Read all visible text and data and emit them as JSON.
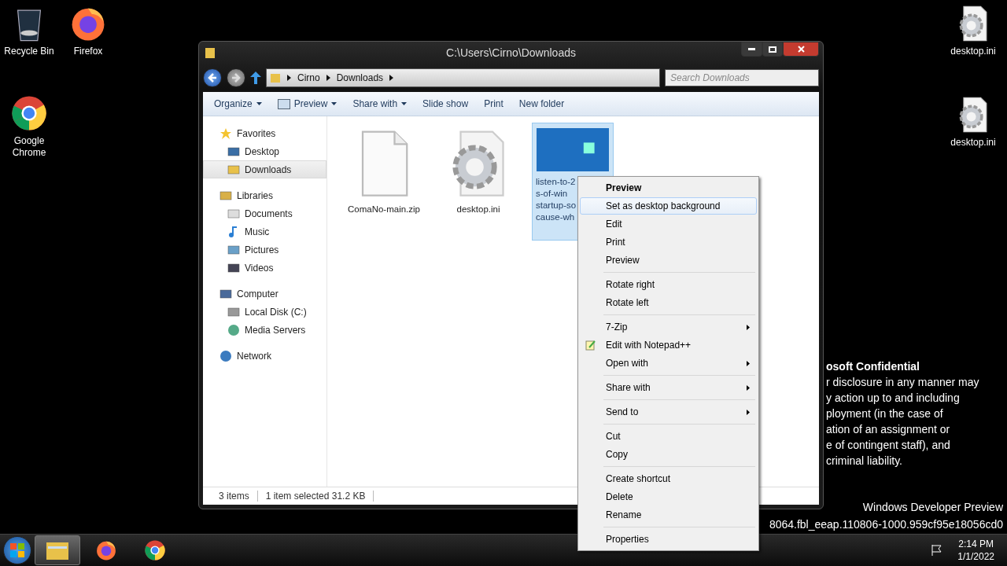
{
  "desktop_icons_left": [
    {
      "label": "Recycle Bin",
      "kind": "bin"
    },
    {
      "label": "Firefox",
      "kind": "firefox"
    },
    {
      "label": "Google Chrome",
      "kind": "chrome"
    }
  ],
  "desktop_icons_right": [
    {
      "label": "desktop.ini",
      "kind": "ini"
    },
    {
      "label": "desktop.ini",
      "kind": "ini"
    }
  ],
  "watermark": {
    "title": "osoft Confidential",
    "lines": [
      "r disclosure in any manner may",
      "y action up to and including",
      "ployment (in the case of",
      "ation of an assignment or",
      "e of contingent staff), and",
      "criminal liability."
    ],
    "edition": "Windows Developer Preview",
    "build": "8064.fbl_eeap.110806-1000.959cf95e18056cd0"
  },
  "window": {
    "title": "C:\\Users\\Cirno\\Downloads",
    "address": [
      "Cirno",
      "Downloads"
    ],
    "search": {
      "placeholder": "Search Downloads"
    },
    "toolbar": [
      {
        "label": "Organize",
        "dropdown": true,
        "kind": "plain"
      },
      {
        "label": "Preview",
        "dropdown": true,
        "kind": "preview"
      },
      {
        "label": "Share with",
        "dropdown": true,
        "kind": "plain"
      },
      {
        "label": "Slide show",
        "dropdown": false,
        "kind": "plain"
      },
      {
        "label": "Print",
        "dropdown": false,
        "kind": "plain"
      },
      {
        "label": "New folder",
        "dropdown": false,
        "kind": "plain"
      }
    ],
    "nav": [
      {
        "label": "Favorites",
        "kind": "star",
        "children": [
          {
            "label": "Desktop",
            "kind": "desktop",
            "selected": false
          },
          {
            "label": "Downloads",
            "kind": "downloads",
            "selected": true
          }
        ]
      },
      {
        "label": "Libraries",
        "kind": "libraries",
        "children": [
          {
            "label": "Documents",
            "kind": "documents",
            "selected": false
          },
          {
            "label": "Music",
            "kind": "music",
            "selected": false
          },
          {
            "label": "Pictures",
            "kind": "pictures",
            "selected": false
          },
          {
            "label": "Videos",
            "kind": "videos",
            "selected": false
          }
        ]
      },
      {
        "label": "Computer",
        "kind": "computer",
        "children": [
          {
            "label": "Local Disk (C:)",
            "kind": "disk",
            "selected": false
          },
          {
            "label": "Media Servers",
            "kind": "media",
            "selected": false
          }
        ]
      },
      {
        "label": "Network",
        "kind": "network"
      }
    ],
    "files": [
      {
        "name": "ComaNo-main.zip",
        "kind": "blank",
        "selected": false
      },
      {
        "name": "desktop.ini",
        "kind": "ini",
        "selected": false
      },
      {
        "name": "listen-to-2\ns-of-win\nstartup-so\ncause-wh",
        "kind": "image",
        "selected": true
      }
    ],
    "status": {
      "count": "3 items",
      "selection": "1 item selected",
      "size": "31.2 KB"
    }
  },
  "context_menu": [
    {
      "label": "Preview",
      "kind": "item",
      "bold": true,
      "selected": false
    },
    {
      "label": "Set as desktop background",
      "kind": "item",
      "bold": false,
      "selected": true
    },
    {
      "label": "Edit",
      "kind": "item",
      "bold": false,
      "selected": false
    },
    {
      "label": "Print",
      "kind": "item",
      "bold": false,
      "selected": false
    },
    {
      "label": "Preview",
      "kind": "item",
      "bold": false,
      "selected": false
    },
    {
      "kind": "separator"
    },
    {
      "label": "Rotate right",
      "kind": "item",
      "bold": false,
      "selected": false
    },
    {
      "label": "Rotate left",
      "kind": "item",
      "bold": false,
      "selected": false
    },
    {
      "kind": "separator"
    },
    {
      "label": "7-Zip",
      "kind": "submenu",
      "bold": false,
      "selected": false
    },
    {
      "label": "Edit with Notepad++",
      "kind": "notepad",
      "bold": false,
      "selected": false
    },
    {
      "label": "Open with",
      "kind": "submenu",
      "bold": false,
      "selected": false
    },
    {
      "kind": "separator"
    },
    {
      "label": "Share with",
      "kind": "submenu",
      "bold": false,
      "selected": false
    },
    {
      "kind": "separator"
    },
    {
      "label": "Send to",
      "kind": "submenu",
      "bold": false,
      "selected": false
    },
    {
      "kind": "separator"
    },
    {
      "label": "Cut",
      "kind": "item",
      "bold": false,
      "selected": false
    },
    {
      "label": "Copy",
      "kind": "item",
      "bold": false,
      "selected": false
    },
    {
      "kind": "separator"
    },
    {
      "label": "Create shortcut",
      "kind": "item",
      "bold": false,
      "selected": false
    },
    {
      "label": "Delete",
      "kind": "item",
      "bold": false,
      "selected": false
    },
    {
      "label": "Rename",
      "kind": "item",
      "bold": false,
      "selected": false
    },
    {
      "kind": "separator"
    },
    {
      "label": "Properties",
      "kind": "item",
      "bold": false,
      "selected": false
    }
  ],
  "taskbar": {
    "apps": [
      {
        "kind": "explorer",
        "active": true
      },
      {
        "kind": "firefox",
        "active": false
      },
      {
        "kind": "chrome",
        "active": false
      }
    ],
    "time": "2:14 PM",
    "date": "1/1/2022"
  }
}
